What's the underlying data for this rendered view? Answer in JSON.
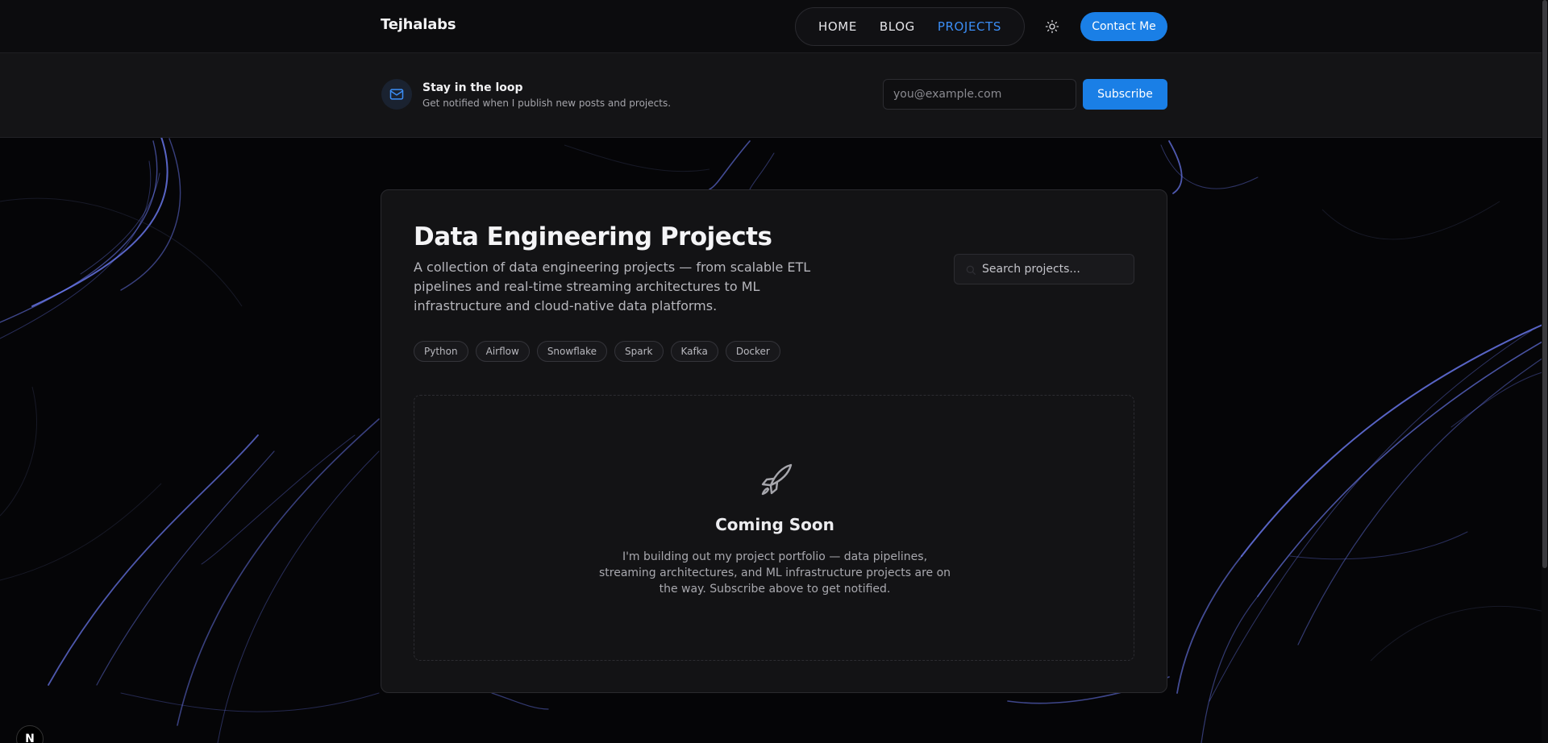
{
  "header": {
    "brand": "Tejhalabs",
    "nav": [
      {
        "label": "HOME",
        "active": false
      },
      {
        "label": "BLOG",
        "active": false
      },
      {
        "label": "PROJECTS",
        "active": true
      }
    ],
    "theme_icon": "sun-icon",
    "contact_label": "Contact Me"
  },
  "subscribe": {
    "icon": "mail-icon",
    "title": "Stay in the loop",
    "description": "Get notified when I publish new posts and projects.",
    "email_placeholder": "you@example.com",
    "button_label": "Subscribe"
  },
  "main": {
    "title": "Data Engineering Projects",
    "description": "A collection of data engineering projects — from scalable ETL pipelines and real-time streaming architectures to ML infrastructure and cloud-native data platforms.",
    "search_placeholder": "Search projects...",
    "tags": [
      "Python",
      "Airflow",
      "Snowflake",
      "Spark",
      "Kafka",
      "Docker"
    ],
    "empty_state": {
      "icon": "rocket-icon",
      "title": "Coming Soon",
      "description": "I'm building out my project portfolio — data pipelines, streaming architectures, and ML infrastructure projects are on the way. Subscribe above to get notified."
    }
  },
  "footer": {
    "dev_badge": "N"
  },
  "colors": {
    "accent": "#1a7fe6",
    "active_nav": "#3b8df5",
    "background": "#050507",
    "card": "#131315",
    "swirl": "#6d7cf5"
  }
}
